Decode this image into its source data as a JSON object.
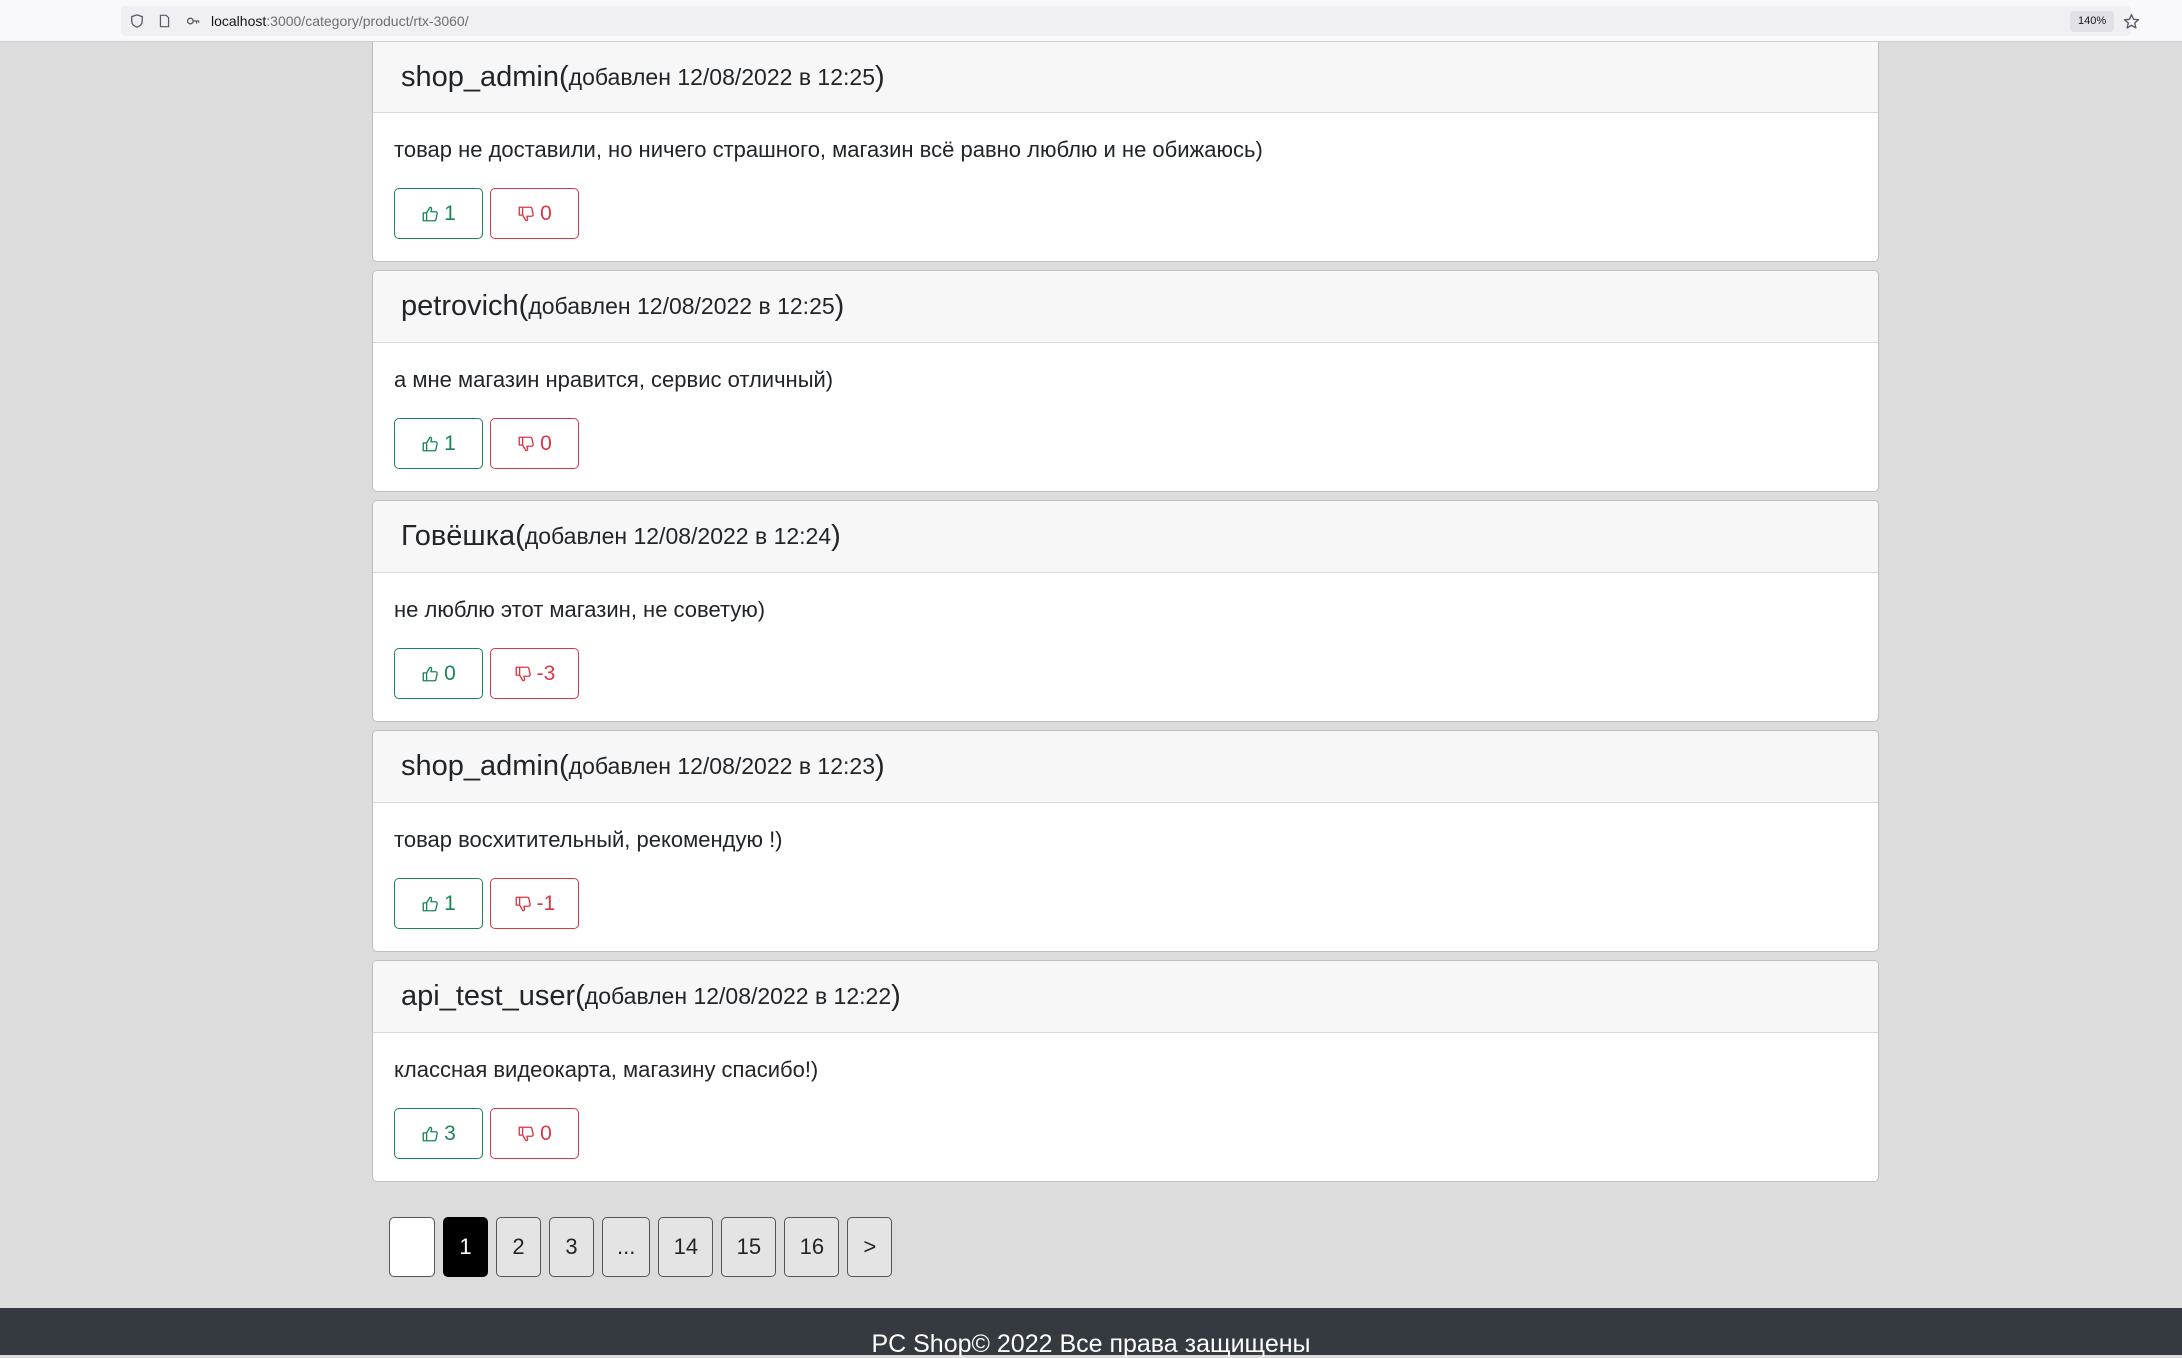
{
  "browser": {
    "url_host": "localhost",
    "url_rest": ":3000/category/product/rtx-3060/",
    "zoom": "140%"
  },
  "reviews": [
    {
      "author": "shop_admin",
      "added": "добавлен 12/08/2022 в 12:25",
      "text": "товар не доставили, но ничего страшного, магазин всё равно люблю и не обижаюсь)",
      "likes": "1",
      "dislikes": "0"
    },
    {
      "author": "petrovich",
      "added": "добавлен 12/08/2022 в 12:25",
      "text": "а мне магазин нравится, сервис отличный)",
      "likes": "1",
      "dislikes": "0"
    },
    {
      "author": "Говёшка",
      "added": "добавлен 12/08/2022 в 12:24",
      "text": "не люблю этот магазин, не советую)",
      "likes": "0",
      "dislikes": "-3"
    },
    {
      "author": "shop_admin",
      "added": "добавлен 12/08/2022 в 12:23",
      "text": "товар восхитительный, рекомендую !)",
      "likes": "1",
      "dislikes": "-1"
    },
    {
      "author": "api_test_user",
      "added": "добавлен 12/08/2022 в 12:22",
      "text": "классная видеокарта, магазину спасибо!)",
      "likes": "3",
      "dislikes": "0"
    }
  ],
  "pagination": {
    "pages": [
      "1",
      "2",
      "3",
      "...",
      "14",
      "15",
      "16",
      ">"
    ],
    "current": "1"
  },
  "footer": {
    "text": "PC Shop© 2022 Все права защищены"
  },
  "colors": {
    "like": "#198754",
    "dislike": "#dc3545",
    "footer_bg": "#343a40",
    "page_bg": "#dcdcdc"
  },
  "icons": {
    "like": "thumbs-up-icon",
    "dislike": "thumbs-down-icon"
  }
}
